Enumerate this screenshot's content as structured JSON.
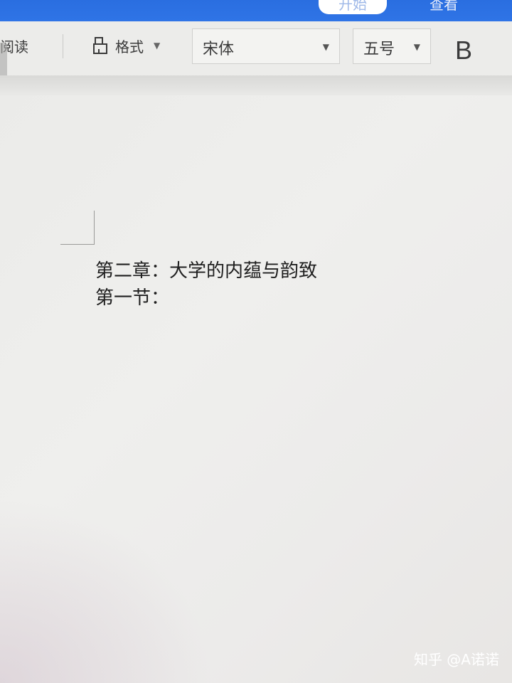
{
  "ribbon": {
    "tabs": [
      {
        "label": "开始"
      },
      {
        "label": "查看"
      }
    ]
  },
  "toolbar": {
    "read_label": "阅读",
    "format_label": "格式",
    "font_family": "宋体",
    "font_size": "五号",
    "bold_label": "B"
  },
  "document": {
    "lines": [
      "第二章：大学的内蕴与韵致",
      "第一节："
    ]
  },
  "watermark": "知乎 @A诺诺"
}
